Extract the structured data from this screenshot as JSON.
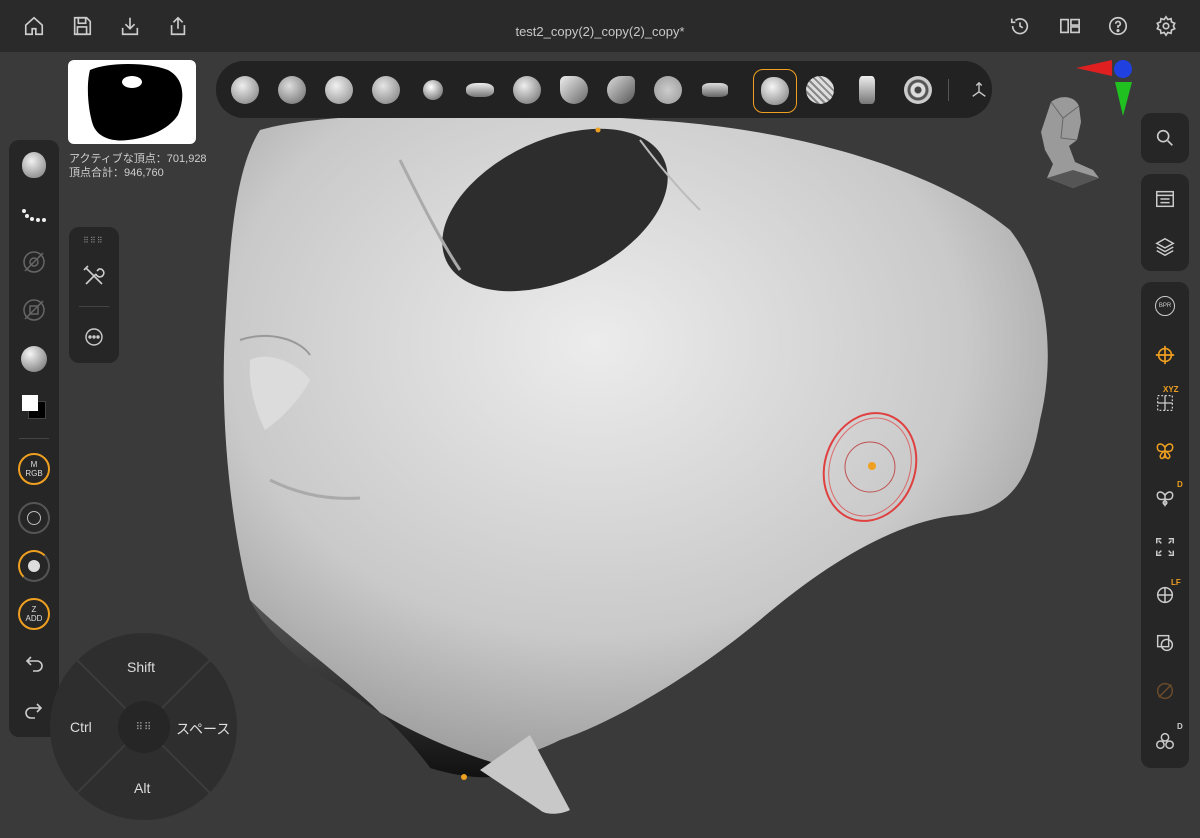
{
  "window": {
    "title": "test2_copy(2)_copy(2)_copy*"
  },
  "topbar": {
    "left_icons": [
      "home-icon",
      "save-icon",
      "download-icon",
      "share-icon"
    ],
    "right_icons": [
      "history-icon",
      "layout-icon",
      "help-icon",
      "settings-icon"
    ]
  },
  "stats": {
    "active_vertices": "アクティブな頂点：701,928",
    "total_vertices": "頂点合計：946,760"
  },
  "brushbar": {
    "brushes": [
      "clay-brush",
      "blob-brush",
      "inflate-brush",
      "flatten-brush",
      "smooth-brush",
      "crease-brush",
      "twist-brush",
      "pinch-brush",
      "planar-brush",
      "flat-brush",
      "spikes-brush",
      "standard-brush",
      "mesh-brush",
      "move-brush",
      "spiral-brush"
    ],
    "active_index": 11
  },
  "left_toolbar": {
    "rgb_label": "M\nRGB",
    "add_label": "Z\nADD"
  },
  "dpad": {
    "up": "Shift",
    "left": "Ctrl",
    "right": "スペース",
    "down": "Alt"
  },
  "right_toolbar": {
    "xyz_badge": "XYZ",
    "d_badge_1": "D",
    "lf_badge": "LF",
    "d_badge_2": "D",
    "bpr_label": "BPR"
  },
  "colors": {
    "accent": "#f0a020",
    "cursor": "#e04040",
    "gizmo_x": "#e02020",
    "gizmo_y": "#20c020",
    "gizmo_z": "#2040e0"
  }
}
